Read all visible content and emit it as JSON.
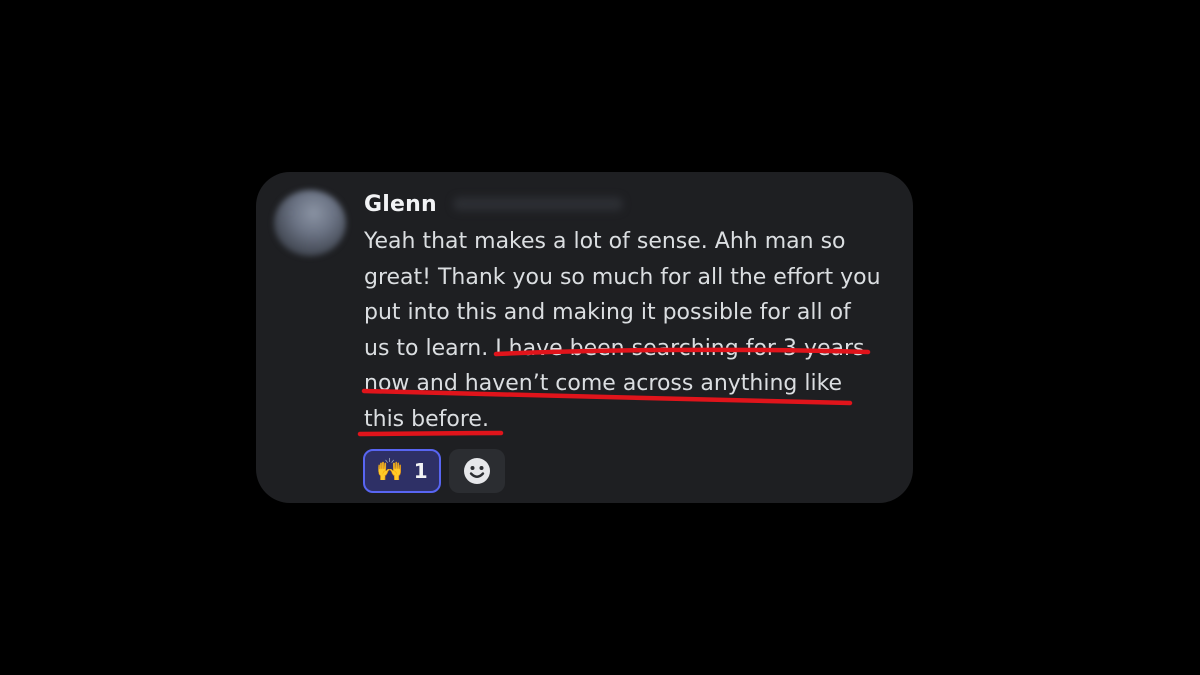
{
  "message": {
    "author": "Glenn",
    "lines": [
      "Yeah that makes a lot of sense. Ahh man so",
      "great! Thank you so much for all the effort you",
      "put into this and making it possible for all of",
      "us to learn. I have been searching for 3 years",
      "now and haven’t come across anything like",
      "this before."
    ]
  },
  "reactions": [
    {
      "emoji": "🙌",
      "count": "1",
      "selected": true
    }
  ],
  "colors": {
    "background": "#000000",
    "card": "#1e1f22",
    "highlight_underline": "#e0141b",
    "reaction_border": "#5865f2",
    "reaction_fill": "#2e3066"
  },
  "icons": {
    "add_reaction": "smiley-face-icon",
    "avatar": "blurred-avatar"
  }
}
